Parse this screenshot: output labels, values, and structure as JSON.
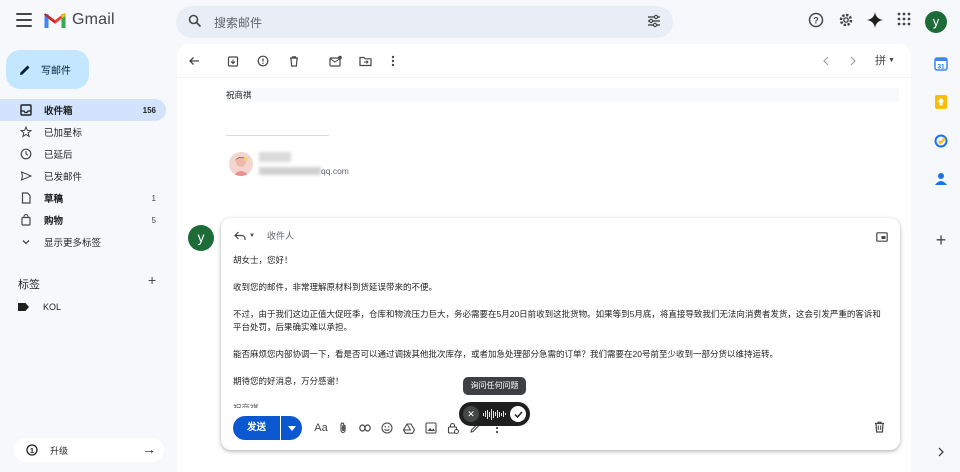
{
  "app": {
    "name": "Gmail"
  },
  "search": {
    "placeholder": "搜索邮件"
  },
  "account": {
    "initial": "y"
  },
  "compose_button": {
    "label": "写邮件"
  },
  "nav": [
    {
      "label": "收件箱",
      "count": "156",
      "icon": "inbox-icon",
      "active": true
    },
    {
      "label": "已加星标",
      "count": "",
      "icon": "star-icon"
    },
    {
      "label": "已延后",
      "count": "",
      "icon": "clock-icon"
    },
    {
      "label": "已发邮件",
      "count": "",
      "icon": "send-icon"
    },
    {
      "label": "草稿",
      "count": "1",
      "icon": "draft-icon",
      "bold": true
    },
    {
      "label": "购物",
      "count": "5",
      "icon": "shopping-icon",
      "bold": true
    },
    {
      "label": "显示更多标签",
      "count": "",
      "icon": "chevron-down-icon"
    }
  ],
  "labels": {
    "heading": "标签",
    "items": [
      "KOL"
    ]
  },
  "upgrade": {
    "label": "升级"
  },
  "message": {
    "quoted_sender": "祝商祺",
    "signature_email_suffix": "qq.com"
  },
  "reply": {
    "avatar_initial": "y",
    "recipients_label": "收件人",
    "paragraphs": [
      "胡女士，您好！",
      "收到您的邮件，非常理解原材料到货延误带来的不便。",
      "不过，由于我们这边正值大促旺季，仓库和物流压力巨大，务必需要在5月20日前收到这批货物。如果等到5月底，将直接导致我们无法向消费者发货，这会引发严重的客诉和平台处罚，后果确实难以承担。",
      "能否麻烦您内部协调一下，看是否可以通过调拨其他批次库存，或者加急处理部分急需的订单？我们需要在20号前至少收到一部分货以维持运转。",
      "期待您的好消息，万分感谢！"
    ],
    "signature": "祝商祺",
    "send_label": "发送"
  },
  "voice": {
    "tooltip": "询问任何问题"
  },
  "toolbar": {
    "input_tool_label": "拼"
  }
}
